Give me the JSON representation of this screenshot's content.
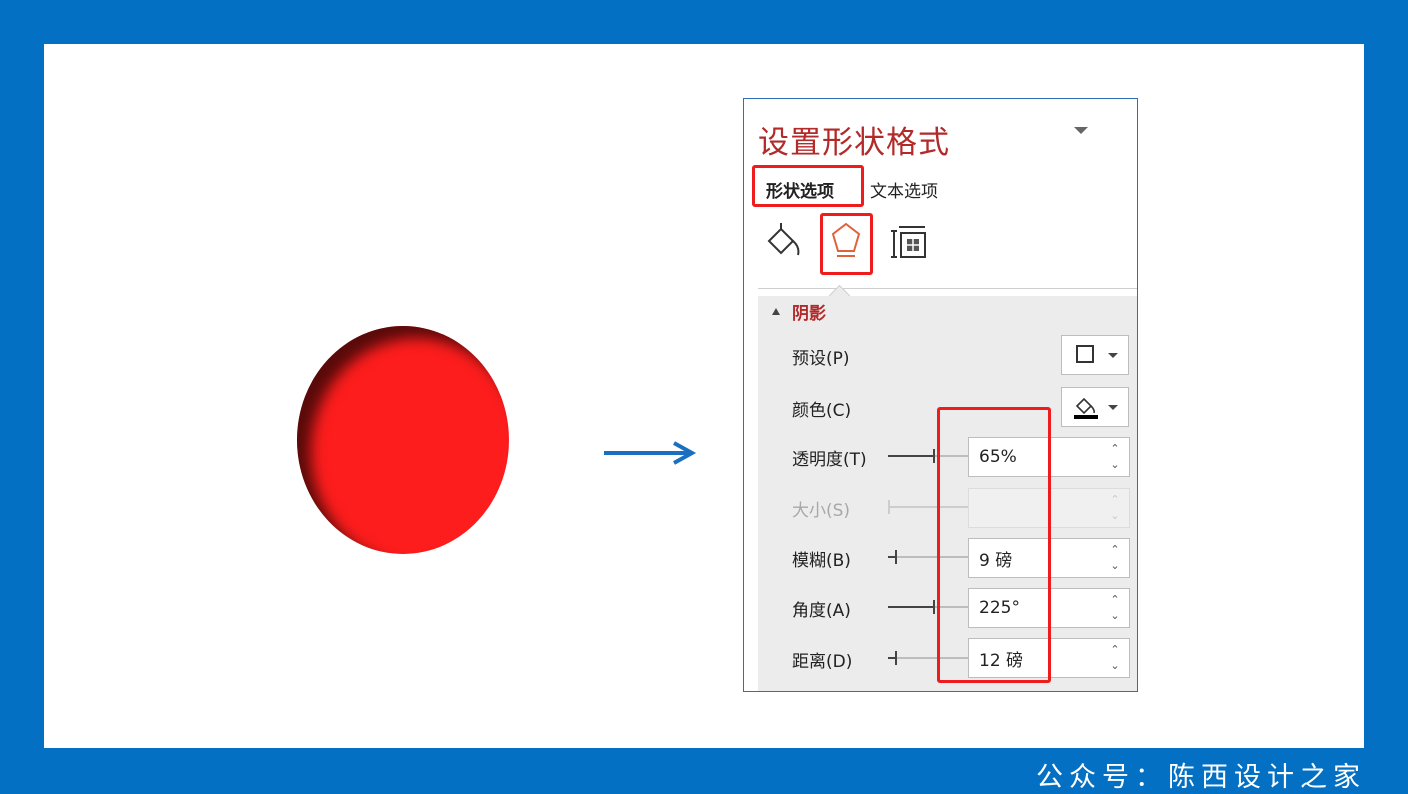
{
  "illustration": {
    "circle_color": "#fd1d1d",
    "arrow_color": "#1a6fc0",
    "arrow_icon": "right-arrow-icon"
  },
  "panel": {
    "title": "设置形状格式",
    "tabs": [
      {
        "label": "形状选项",
        "active": true
      },
      {
        "label": "文本选项",
        "active": false
      }
    ],
    "icon_tabs": [
      "fill-line-icon",
      "effects-pentagon-icon",
      "size-properties-icon"
    ],
    "section": {
      "title": "阴影",
      "rows": {
        "preset": {
          "label": "预设(P)",
          "icon": "shadow-preset-square-icon"
        },
        "color": {
          "label": "颜色(C)",
          "icon": "paint-bucket-icon"
        },
        "transparency": {
          "label": "透明度(T)",
          "value": "65%",
          "level": 0.65
        },
        "size": {
          "label": "大小(S)",
          "value": "",
          "disabled": true
        },
        "blur": {
          "label": "模糊(B)",
          "value": "9 磅"
        },
        "angle": {
          "label": "角度(A)",
          "value": "225°",
          "level": 0.625
        },
        "distance": {
          "label": "距离(D)",
          "value": "12 磅"
        }
      }
    }
  },
  "watermark": "公众号：陈西设计之家",
  "colors": {
    "frame_blue": "#0470c3",
    "title_red": "#b22a2a",
    "highlight_red": "#ee1c1c"
  }
}
